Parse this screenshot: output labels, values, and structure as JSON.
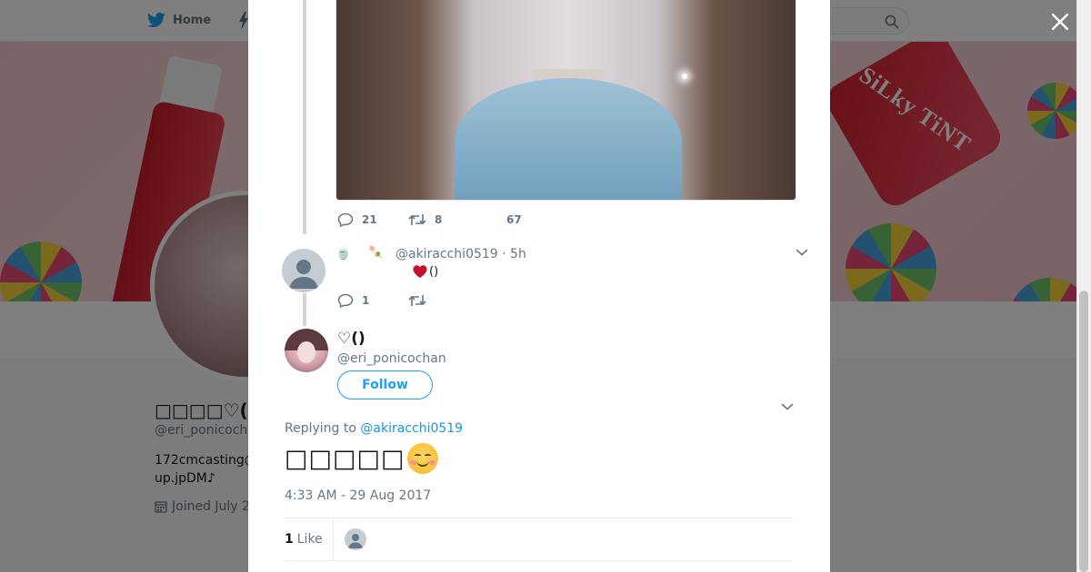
{
  "nav": {
    "home_label": "Home"
  },
  "profile_background": {
    "display_name": "□□□□♡(□□",
    "handle": "@eri_ponicoch",
    "bio": "172cmcasting@\nup.jpDM♪",
    "joined_text": "Joined July 2",
    "banner_text": "SiLky TiNT"
  },
  "modal": {
    "parent_tweet_actions": {
      "replies": "21",
      "retweets": "8",
      "likes": "67"
    },
    "reply_tweet": {
      "emoji_cup": "🍵",
      "emoji_dango": "🍡",
      "handle_time": "@akiracchi0519 · 5h",
      "text_suffix": "()",
      "replies": "1"
    },
    "main_tweet": {
      "display_name": "♡()",
      "handle": "@eri_ponicochan",
      "follow_label": "Follow",
      "replying_prefix": "Replying to ",
      "replying_to": "@akiracchi0519",
      "text": "□□□□□",
      "timestamp": "4:33 AM - 29 Aug 2017",
      "likes_count": "1",
      "likes_label": "Like"
    }
  },
  "colors": {
    "brand_blue": "#1da1f2",
    "link_blue": "#1b95e0",
    "muted_gray": "#657786",
    "heart_red": "#e0245e"
  },
  "icons": [
    "twitter-bird-icon",
    "search-icon",
    "reply-icon",
    "retweet-icon",
    "heart-icon",
    "chevron-down-icon",
    "close-icon",
    "calendar-icon",
    "default-avatar-icon",
    "smiling-face-icon"
  ]
}
